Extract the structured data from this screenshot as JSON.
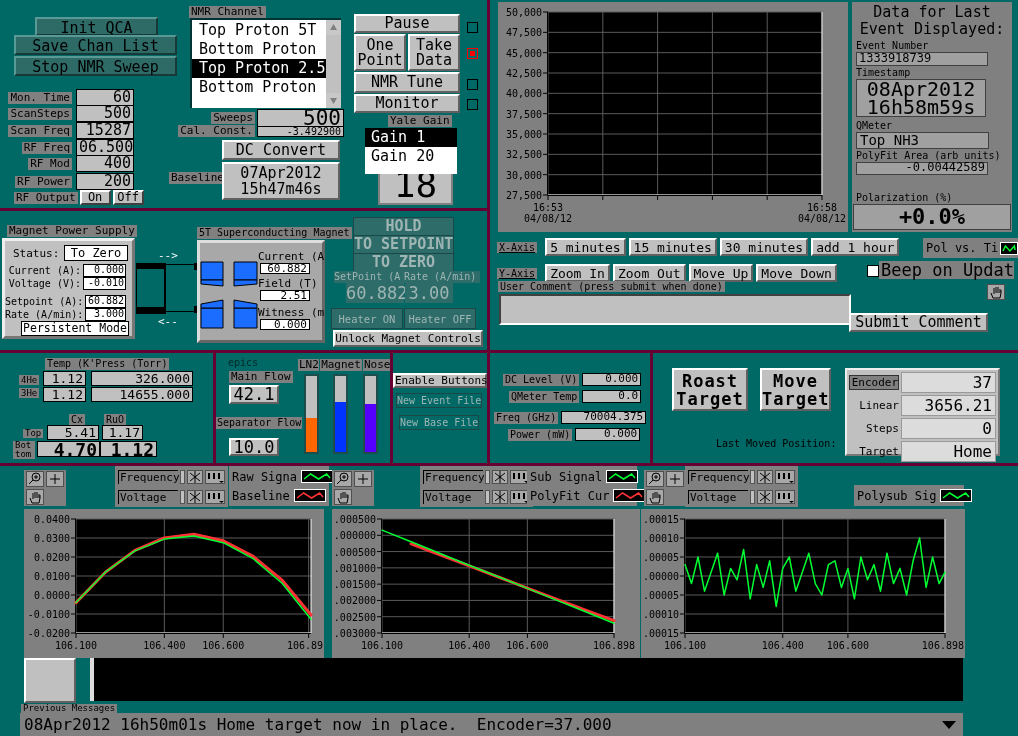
{
  "qca_buttons": [
    "Init QCA",
    "Save Chan List",
    "Stop NMR Sweep"
  ],
  "settings": [
    {
      "label": "Mon. Time",
      "value": "60"
    },
    {
      "label": "ScanSteps",
      "value": "500"
    },
    {
      "label": "Scan Freq",
      "value": "15287"
    },
    {
      "label": "RF Freq",
      "value": "06.500"
    },
    {
      "label": "RF Mod",
      "value": "400"
    },
    {
      "label": "RF Power",
      "value": "200"
    }
  ],
  "rf_output": {
    "label": "RF Output",
    "options": [
      "On",
      "Off"
    ]
  },
  "nmr_channel": {
    "label": "NMR Channel",
    "items": [
      {
        "label": "Top Proton 5T",
        "selected": false
      },
      {
        "label": "Bottom Proton",
        "selected": false
      },
      {
        "label": "Top Proton 2.5",
        "selected": true
      },
      {
        "label": "Bottom Proton",
        "selected": false
      }
    ]
  },
  "sweeps": {
    "label": "Sweeps",
    "value": "500"
  },
  "cal_const": {
    "label": "Cal. Const.",
    "value": "-3.492900"
  },
  "dc_convert": "DC Convert",
  "baseline": {
    "label": "Baseline",
    "value": "07Apr2012 15h47m46s"
  },
  "run_buttons": [
    {
      "labels": [
        "Pause"
      ],
      "lit": false
    },
    {
      "labels": [
        "One Point",
        "Take Data"
      ],
      "lit": true
    },
    {
      "labels": [
        "NMR Tune"
      ],
      "lit": false
    },
    {
      "labels": [
        "Monitor"
      ],
      "lit": false
    }
  ],
  "yale_gain": {
    "label": "Yale Gain",
    "items": [
      {
        "label": "Gain 1",
        "selected": true
      },
      {
        "label": "Gain 20",
        "selected": false
      }
    ],
    "value": "18"
  },
  "trend_chart": {
    "chart_data": {
      "type": "line",
      "grid": true,
      "categories": [
        "16:53 04/08/12",
        null,
        null,
        null,
        null,
        "16:58 04/08/12"
      ],
      "ylim": [
        27500,
        50000
      ],
      "yticks": [
        {
          "value": 50000,
          "label": "50,000"
        },
        {
          "value": 47500,
          "label": "47,500"
        },
        {
          "value": 45000,
          "label": "45,000"
        },
        {
          "value": 42500,
          "label": "42,500"
        },
        {
          "value": 40000,
          "label": "40,000"
        },
        {
          "value": 37500,
          "label": "37,500"
        },
        {
          "value": 35000,
          "label": "35,000"
        },
        {
          "value": 32500,
          "label": "32,500"
        },
        {
          "value": 30000,
          "label": "30,000"
        },
        {
          "value": 27500,
          "label": "27,500"
        }
      ]
    }
  },
  "last_event": {
    "title": "Data for Last Event Displayed:",
    "fields": [
      {
        "label": "Event Number",
        "value": "1333918739"
      },
      {
        "label": "Timestamp",
        "value": "08Apr2012 16h58m59s"
      },
      {
        "label": "QMeter",
        "value": "Top NH3"
      },
      {
        "label": "PolyFit Area (arb units)",
        "value": "-0.00442589"
      },
      {
        "label": "Polarization (%)",
        "value": "+0.0%"
      }
    ]
  },
  "x_axis": {
    "label": "X-Axis",
    "buttons": [
      "5 minutes",
      "15 minutes",
      "30 minutes",
      "add 1 hour"
    ]
  },
  "y_axis": {
    "label": "Y-Axis",
    "buttons": [
      "Zoom In",
      "Zoom Out",
      "Move Up",
      "Move Down"
    ]
  },
  "trend_legend": {
    "name": "Pol vs. Ti"
  },
  "beep": {
    "label": "Beep on Updat",
    "checked": false
  },
  "comment": {
    "label": "User Comment (press submit when done)",
    "button": "Submit Comment"
  },
  "power_supply": {
    "title": "Magnet Power Supply",
    "status_label": "Status:",
    "status": "To Zero",
    "fields": [
      {
        "label": "Current (A):",
        "value": "0.000"
      },
      {
        "label": "Voltage (V):",
        "value": "-0.010"
      },
      {
        "label": "Setpoint (A):",
        "value": "60.882"
      },
      {
        "label": "Rate (A/min):",
        "value": "3.000"
      }
    ],
    "mode": "Persistent Mode"
  },
  "magnet_arrows": [
    "-->",
    "<--"
  ],
  "magnet": {
    "title": "5T Superconducting Magnet",
    "fields": [
      {
        "label": "Current (A",
        "value": "60.882"
      },
      {
        "label": "Field (T)",
        "value": "2.51"
      },
      {
        "label": "Witness (m",
        "value": "0.000"
      }
    ]
  },
  "magnet_controls": {
    "disabled": true,
    "modes": [
      "HOLD",
      "TO SETPOINT",
      "TO ZERO"
    ],
    "setpoint_label": "SetPoint (A",
    "rate_label": "Rate (A/min)",
    "setpoint": "60.882",
    "rate": "3.00",
    "heater": [
      "Heater ON",
      "Heater OFF"
    ],
    "unlock": "Unlock Magnet Controls"
  },
  "temperatures": {
    "header": "Temp (K'Press (Torr)",
    "rows": [
      {
        "label": "4He",
        "temp": "1.12",
        "pressure": "326.000"
      },
      {
        "label": "3He",
        "temp": "1.12",
        "pressure": "14655.000"
      }
    ],
    "columns": [
      "Cx",
      "RuO"
    ],
    "sensors": [
      {
        "label": "Top",
        "values": [
          "5.41",
          "1.17"
        ]
      },
      {
        "label": "Bottom",
        "values": [
          "4.70",
          "1.12"
        ]
      }
    ]
  },
  "flows": {
    "caption": "epics",
    "main": {
      "label": "Main Flow",
      "value": "42.1"
    },
    "separator": {
      "label": "Separator Flow",
      "value": "10.0"
    },
    "levels": [
      {
        "label": "LN2",
        "level": 0.45,
        "color": "#ff6600"
      },
      {
        "label": "Magnet",
        "level": 0.66,
        "color": "#0033ff"
      },
      {
        "label": "Nose",
        "level": 0.63,
        "color": "#5500ff"
      }
    ]
  },
  "file_buttons": [
    {
      "label": "Enable Buttons",
      "disabled": false
    },
    {
      "label": "New Event File",
      "disabled": true
    },
    {
      "label": "New Base File",
      "disabled": true
    }
  ],
  "qmeter": [
    {
      "label": "DC Level (V)",
      "value": "0.000"
    },
    {
      "label": "QMeter Temp",
      "value": "0.0"
    },
    {
      "label": "Freq (GHz)",
      "value": "70004.375"
    },
    {
      "label": "Power (mW)",
      "value": "0.000"
    }
  ],
  "target": {
    "buttons": [
      "Roast Target",
      "Move Target"
    ],
    "caption": "Last Moved Position:",
    "fields": [
      {
        "label": "Encoder",
        "value": "37"
      },
      {
        "label": "Linear",
        "value": "3656.21"
      },
      {
        "label": "Steps",
        "value": "0"
      },
      {
        "label": "Target",
        "value": "Home"
      }
    ]
  },
  "graphs": [
    {
      "cursors": [
        "Frequency",
        "Voltage"
      ],
      "chart_data": {
        "type": "line",
        "grid": true,
        "xlim": [
          106.1,
          106.898
        ],
        "ylim": [
          -0.02,
          0.04
        ],
        "xticks": [
          {
            "value": 106.1,
            "label": "106.100"
          },
          {
            "value": 106.4,
            "label": "106.400"
          },
          {
            "value": 106.6,
            "label": "106.600"
          },
          {
            "value": 106.89,
            "label": "106.89"
          }
        ],
        "yticks": [
          {
            "value": 0.04,
            "label": "0.0400"
          },
          {
            "value": 0.03,
            "label": "0.0300"
          },
          {
            "value": 0.02,
            "label": "0.0200"
          },
          {
            "value": 0.01,
            "label": "0.0100"
          },
          {
            "value": 0,
            "label": "0.0000"
          },
          {
            "value": -0.01,
            "label": "-0.0100"
          },
          {
            "value": -0.02,
            "label": "-0.0200"
          }
        ],
        "x": [
          106.1,
          106.2,
          106.3,
          106.4,
          106.5,
          106.6,
          106.7,
          106.8,
          106.898
        ],
        "series": [
          {
            "name": "Raw Signa",
            "color": "#00ff33",
            "values": [
              -0.004,
              0.012,
              0.0232,
              0.0294,
              0.031,
              0.0275,
              0.0193,
              0.0062,
              -0.0128
            ]
          },
          {
            "name": "Baseline",
            "color": "#ff3333",
            "values": [
              -0.004,
              0.012,
              0.0235,
              0.03,
              0.032,
              0.0285,
              0.0205,
              0.0078,
              -0.0105
            ]
          }
        ]
      }
    },
    {
      "cursors": [
        "Frequency",
        "Voltage"
      ],
      "chart_data": {
        "type": "line",
        "grid": true,
        "xlim": [
          106.1,
          106.898
        ],
        "ylim": [
          -0.003,
          0.0005
        ],
        "xticks": [
          {
            "value": 106.1,
            "label": "106.100"
          },
          {
            "value": 106.4,
            "label": "106.400"
          },
          {
            "value": 106.6,
            "label": "106.600"
          },
          {
            "value": 106.898,
            "label": "106.898"
          }
        ],
        "yticks": [
          {
            "value": 0.0005,
            "label": ".000500"
          },
          {
            "value": 0,
            "label": ".000000"
          },
          {
            "value": -0.0005,
            "label": ".000500"
          },
          {
            "value": -0.001,
            "label": ".001000"
          },
          {
            "value": -0.0015,
            "label": ".001500"
          },
          {
            "value": -0.002,
            "label": ".002000"
          },
          {
            "value": -0.0025,
            "label": ".002500"
          },
          {
            "value": -0.003,
            "label": ".003000"
          }
        ],
        "x": [
          106.1,
          106.2,
          106.3,
          106.4,
          106.5,
          106.6,
          106.7,
          106.8,
          106.898
        ],
        "series": [
          {
            "name": "Sub Signal",
            "color": "#00ff33",
            "values": [
              0.00016,
              -0.0002,
              -0.00056,
              -0.00092,
              -0.00127,
              -0.00163,
              -0.00199,
              -0.00235,
              -0.0027
            ]
          },
          {
            "name": "PolyFit Cur",
            "color": "#ff3333",
            "values": [
              null,
              -0.00026,
              -0.0006,
              -0.00094,
              -0.00128,
              -0.00162,
              -0.00196,
              -0.0023,
              -0.00262
            ]
          }
        ]
      }
    },
    {
      "cursors": [
        "Frequency",
        "Voltage"
      ],
      "chart_data": {
        "type": "line",
        "grid": true,
        "xlim": [
          106.1,
          106.898
        ],
        "ylim": [
          -0.00015,
          0.00015
        ],
        "xticks": [
          {
            "value": 106.1,
            "label": "106.100"
          },
          {
            "value": 106.4,
            "label": "106.400"
          },
          {
            "value": 106.6,
            "label": "106.600"
          },
          {
            "value": 106.898,
            "label": "106.898"
          }
        ],
        "yticks": [
          {
            "value": 0.00015,
            "label": ".00015"
          },
          {
            "value": 0.0001,
            "label": ".00010"
          },
          {
            "value": 5e-05,
            "label": ".00005"
          },
          {
            "value": 0,
            "label": ".00000"
          },
          {
            "value": -5e-05,
            "label": ".00005"
          },
          {
            "value": -0.0001,
            "label": ".00010"
          },
          {
            "value": -0.00015,
            "label": ".00015"
          }
        ],
        "x": [
          106.1,
          106.12,
          106.14,
          106.16,
          106.18,
          106.2,
          106.22,
          106.24,
          106.26,
          106.28,
          106.3,
          106.32,
          106.34,
          106.36,
          106.38,
          106.4,
          106.42,
          106.44,
          106.46,
          106.48,
          106.5,
          106.52,
          106.54,
          106.56,
          106.58,
          106.6,
          106.62,
          106.64,
          106.66,
          106.68,
          106.7,
          106.72,
          106.74,
          106.76,
          106.78,
          106.8,
          106.82,
          106.84,
          106.86,
          106.88,
          106.898
        ],
        "series": [
          {
            "name": "Polysub Sig",
            "color": "#00ff33",
            "values": [
              3e-05,
              -2e-05,
              5e-05,
              -4e-05,
              1e-05,
              6e-05,
              -5e-05,
              2e-05,
              -1e-05,
              7e-05,
              -6e-05,
              3e-05,
              -3e-05,
              4e-05,
              -8e-05,
              2e-05,
              5e-05,
              -4e-05,
              1e-05,
              6e-05,
              -2e-05,
              -5e-05,
              3e-05,
              4e-05,
              -3e-05,
              2e-05,
              -6e-05,
              5e-05,
              -1e-05,
              3e-05,
              -4e-05,
              6e-05,
              -2e-05,
              2e-05,
              -5e-05,
              4e-05,
              0.0001,
              -3e-05,
              5e-05,
              -2e-05,
              1e-05
            ]
          }
        ]
      }
    }
  ],
  "messages": {
    "label": "Previous Messages",
    "current": "08Apr2012 16h50m01s Home target now in place.  Encoder=37.000"
  }
}
